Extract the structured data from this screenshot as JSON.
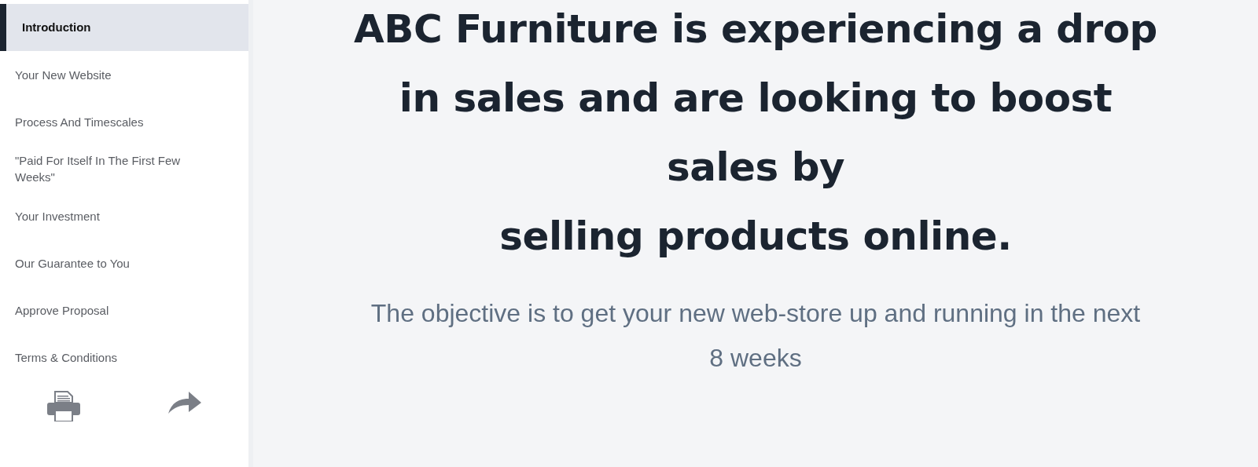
{
  "sidebar": {
    "items": [
      {
        "label": "Introduction",
        "selected": true
      },
      {
        "label": "Your New Website",
        "selected": false
      },
      {
        "label": "Process And Timescales",
        "selected": false
      },
      {
        "label": "\"Paid For Itself In The First Few Weeks\"",
        "selected": false
      },
      {
        "label": "Your Investment",
        "selected": false
      },
      {
        "label": "Our Guarantee to You",
        "selected": false
      },
      {
        "label": "Approve Proposal",
        "selected": false
      },
      {
        "label": "Terms & Conditions",
        "selected": false
      }
    ]
  },
  "main": {
    "heading_lines": [
      "ABC Furniture is experiencing a drop",
      "in sales and are looking to boost",
      "sales by",
      "selling products online."
    ],
    "subtitle": "The objective is to get your new web-store up and running in the next 8 weeks"
  }
}
